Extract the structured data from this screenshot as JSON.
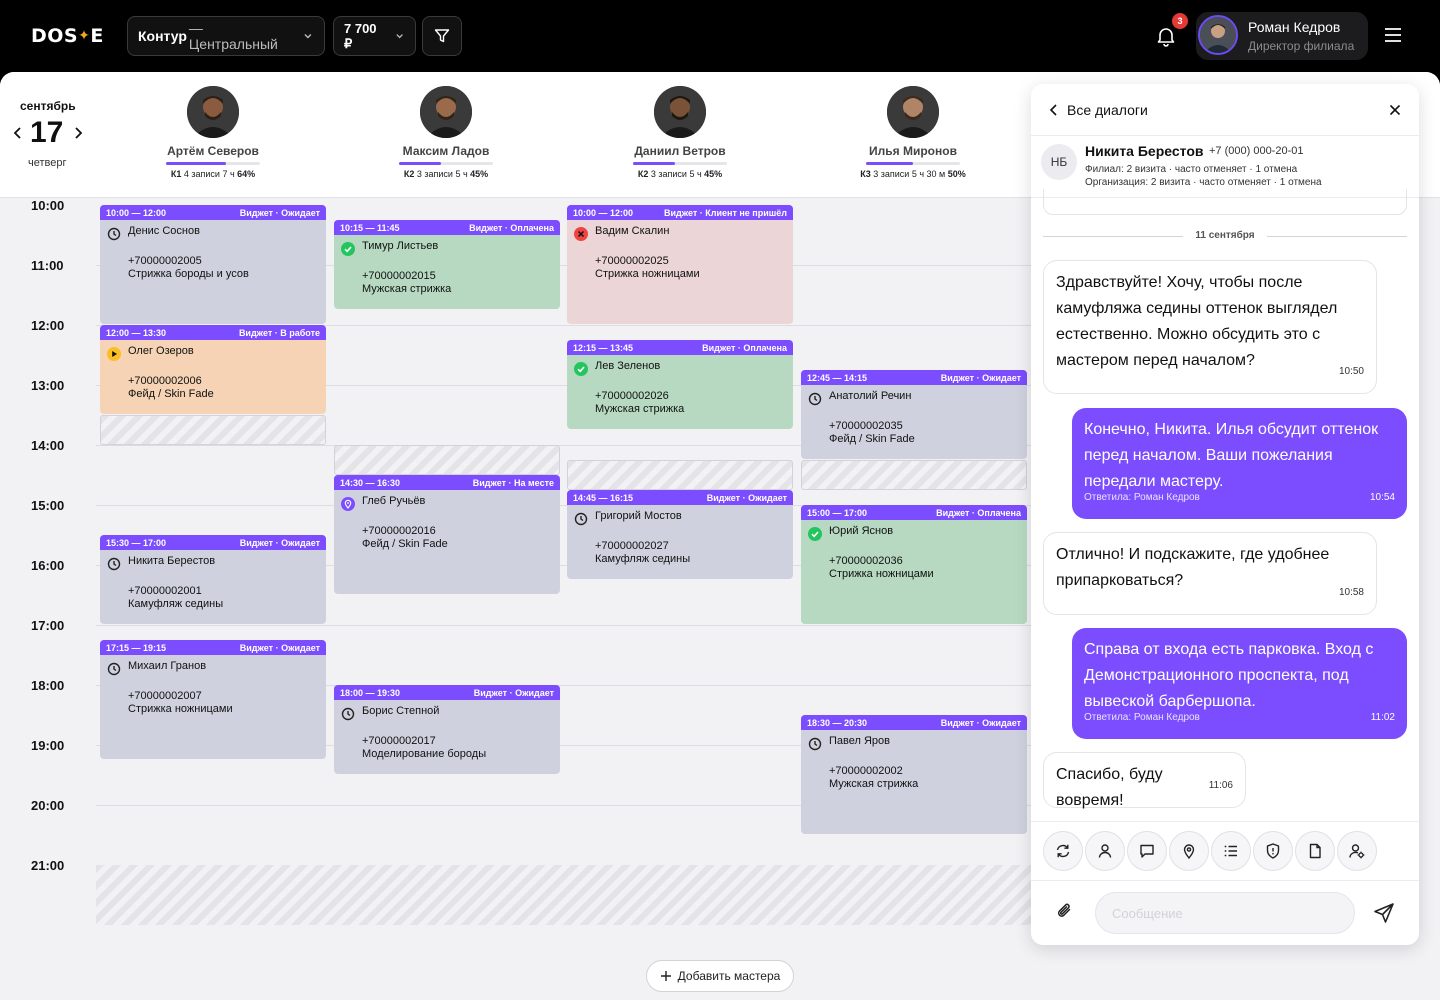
{
  "topbar": {
    "logo_left": "DOS",
    "logo_star": "✦",
    "logo_right": "E",
    "branch_bold": "Контур",
    "branch_name": "— Центральный",
    "price": "7 700 ₽",
    "notifications": "3",
    "user_name": "Роман Кедров",
    "user_role": "Директор филиала"
  },
  "date": {
    "month": "сентябрь",
    "day": "17",
    "weekday": "четверг"
  },
  "masters": [
    {
      "name": "Артём Северов",
      "level": "К1",
      "records": "4 записи",
      "hours": "7 ч",
      "load": "64%",
      "load_value": 64
    },
    {
      "name": "Максим Ладов",
      "level": "К2",
      "records": "3 записи",
      "hours": "5 ч",
      "load": "45%",
      "load_value": 45
    },
    {
      "name": "Даниил Ветров",
      "level": "К2",
      "records": "3 записи",
      "hours": "5 ч",
      "load": "45%",
      "load_value": 45
    },
    {
      "name": "Илья Миронов",
      "level": "К3",
      "records": "3 записи",
      "hours": "5 ч 30 м",
      "load": "50%",
      "load_value": 50
    }
  ],
  "hours": [
    "10:00",
    "11:00",
    "12:00",
    "13:00",
    "14:00",
    "15:00",
    "16:00",
    "17:00",
    "18:00",
    "19:00",
    "20:00",
    "21:00"
  ],
  "appointments": [
    {
      "master": 0,
      "time": "10:00 — 12:00",
      "status": "Виджет · Ожидает",
      "kind": "wait",
      "client": "Денис Соснов",
      "phone": "+70000002005",
      "service": "Стрижка бороды и усов"
    },
    {
      "master": 0,
      "time": "12:00 — 13:30",
      "status": "Виджет · В работе",
      "kind": "work",
      "client": "Олег Озеров",
      "phone": "+70000002006",
      "service": "Фейд / Skin Fade"
    },
    {
      "master": 0,
      "time": "15:30 — 17:00",
      "status": "Виджет · Ожидает",
      "kind": "wait",
      "client": "Никита Берестов",
      "phone": "+70000002001",
      "service": "Камуфляж седины"
    },
    {
      "master": 0,
      "time": "17:15 — 19:15",
      "status": "Виджет · Ожидает",
      "kind": "wait",
      "client": "Михаил Гранов",
      "phone": "+70000002007",
      "service": "Стрижка ножницами"
    },
    {
      "master": 1,
      "time": "10:15 — 11:45",
      "status": "Виджет · Оплачена",
      "kind": "paid",
      "client": "Тимур Листьев",
      "phone": "+70000002015",
      "service": "Мужская стрижка"
    },
    {
      "master": 1,
      "time": "14:30 — 16:30",
      "status": "Виджет · На месте",
      "kind": "here",
      "client": "Глеб Ручьёв",
      "phone": "+70000002016",
      "service": "Фейд / Skin Fade"
    },
    {
      "master": 1,
      "time": "18:00 — 19:30",
      "status": "Виджет · Ожидает",
      "kind": "wait",
      "client": "Борис Степной",
      "phone": "+70000002017",
      "service": "Моделирование бороды"
    },
    {
      "master": 2,
      "time": "10:00 — 12:00",
      "status": "Виджет · Клиент не пришёл",
      "kind": "noshow",
      "client": "Вадим Скалин",
      "phone": "+70000002025",
      "service": "Стрижка ножницами"
    },
    {
      "master": 2,
      "time": "12:15 — 13:45",
      "status": "Виджет · Оплачена",
      "kind": "paid",
      "client": "Лев Зеленов",
      "phone": "+70000002026",
      "service": "Мужская стрижка"
    },
    {
      "master": 2,
      "time": "14:45 — 16:15",
      "status": "Виджет · Ожидает",
      "kind": "wait",
      "client": "Григорий Мостов",
      "phone": "+70000002027",
      "service": "Камуфляж седины"
    },
    {
      "master": 3,
      "time": "12:45 — 14:15",
      "status": "Виджет · Ожидает",
      "kind": "wait",
      "client": "Анатолий Речин",
      "phone": "+70000002035",
      "service": "Фейд / Skin Fade"
    },
    {
      "master": 3,
      "time": "15:00 — 17:00",
      "status": "Виджет · Оплачена",
      "kind": "paid",
      "client": "Юрий Яснов",
      "phone": "+70000002036",
      "service": "Стрижка ножницами"
    },
    {
      "master": 3,
      "time": "18:30 — 20:30",
      "status": "Виджет · Ожидает",
      "kind": "wait",
      "client": "Павел Яров",
      "phone": "+70000002002",
      "service": "Мужская стрижка"
    }
  ],
  "add_master_label": "Добавить мастера",
  "chat": {
    "back_label": "Все диалоги",
    "initials": "НБ",
    "client_name": "Никита Берестов",
    "client_phone": "+7 (000) 000-20-01",
    "branch_stats": "Филиал: 2 визита · часто отменяет · 1 отмена",
    "org_stats": "Организация: 2 визита · часто отменяет · 1 отмена",
    "day_label": "11 сентября",
    "messages": [
      {
        "dir": "in",
        "text": "Здравствуйте! Хочу, чтобы после камуфляжа седины оттенок выглядел естественно. Можно обсудить это с мастером перед началом?",
        "time": "10:50"
      },
      {
        "dir": "out",
        "text": "Конечно, Никита. Илья обсудит оттенок перед началом. Ваши пожелания передали мастеру.",
        "by": "Ответила: Роман Кедров",
        "time": "10:54"
      },
      {
        "dir": "in",
        "text": "Отлично! И подскажите, где удобнее припарковаться?",
        "time": "10:58"
      },
      {
        "dir": "out",
        "text": "Справа от входа есть парковка. Вход с Демонстрационного проспекта, под вывеской барбершопа.",
        "by": "Ответила: Роман Кедров",
        "time": "11:02"
      },
      {
        "dir": "in",
        "text": "Спасибо, буду вовремя!",
        "time": "11:06"
      }
    ],
    "input_placeholder": "Сообщение",
    "tools": [
      "refresh-icon",
      "user-icon",
      "message-icon",
      "location-icon",
      "list-icon",
      "shield-icon",
      "file-icon",
      "user-settings-icon"
    ]
  },
  "colors": {
    "accent": "#7b4dff",
    "wait": "#cfd2de",
    "paid": "#b7d9c2",
    "work": "#f5d3b4",
    "noshow": "#ebd5d6",
    "status_ok": "#22c55e",
    "status_cancel": "#ef4444",
    "status_work": "#fbbf24"
  }
}
